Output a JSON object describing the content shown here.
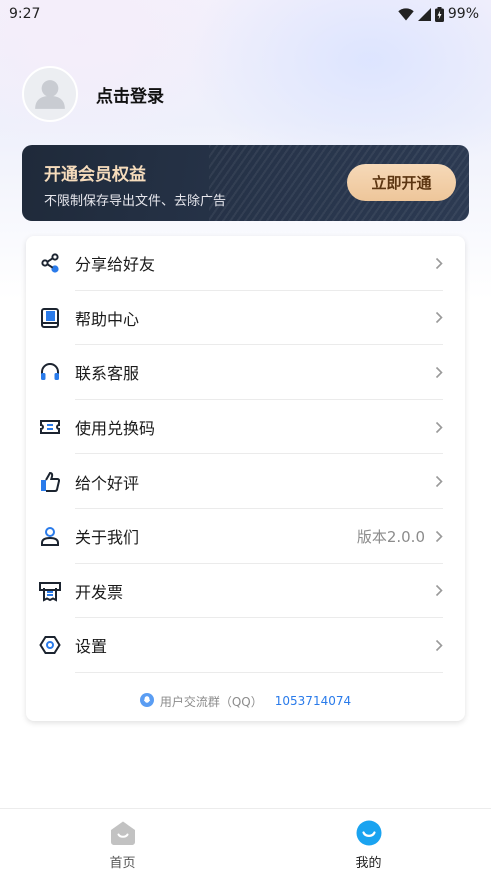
{
  "status_bar": {
    "time": "9:27",
    "battery": "99%"
  },
  "profile": {
    "login_label": "点击登录"
  },
  "vip": {
    "title": "开通会员权益",
    "subtitle": "不限制保存导出文件、去除广告",
    "button_label": "立即开通"
  },
  "menu": {
    "items": [
      {
        "label": "分享给好友",
        "icon": "share-icon",
        "value": ""
      },
      {
        "label": "帮助中心",
        "icon": "book-icon",
        "value": ""
      },
      {
        "label": "联系客服",
        "icon": "headset-icon",
        "value": ""
      },
      {
        "label": "使用兑换码",
        "icon": "ticket-icon",
        "value": ""
      },
      {
        "label": "给个好评",
        "icon": "thumbs-up-icon",
        "value": ""
      },
      {
        "label": "关于我们",
        "icon": "user-icon",
        "value": "版本2.0.0"
      },
      {
        "label": "开发票",
        "icon": "invoice-icon",
        "value": ""
      },
      {
        "label": "设置",
        "icon": "settings-icon",
        "value": ""
      }
    ],
    "qq_label": "用户交流群（QQ）",
    "qq_number": "1053714074"
  },
  "tabbar": {
    "tabs": [
      {
        "label": "首页",
        "icon": "home-icon",
        "active": false
      },
      {
        "label": "我的",
        "icon": "profile-smile-icon",
        "active": true
      }
    ]
  },
  "colors": {
    "accent": "#2a7bea",
    "vip_gold": "#f6dcbc",
    "vip_bg": "#1f2a3a",
    "tab_active": "#1aa3f0",
    "tab_inactive": "#bfbfbf"
  }
}
